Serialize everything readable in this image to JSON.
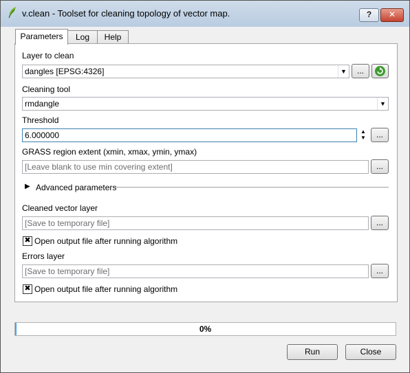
{
  "window": {
    "title": "v.clean - Toolset for cleaning topology of vector map.",
    "help_label": "?",
    "close_label": "✕"
  },
  "tabs": [
    {
      "label": "Parameters",
      "active": true
    },
    {
      "label": "Log",
      "active": false
    },
    {
      "label": "Help",
      "active": false
    }
  ],
  "params": {
    "layer_label": "Layer to clean",
    "layer_value": "dangles [EPSG:4326]",
    "cleaning_label": "Cleaning tool",
    "cleaning_value": "rmdangle",
    "threshold_label": "Threshold",
    "threshold_value": "6.000000",
    "region_label": "GRASS region extent (xmin, xmax, ymin, ymax)",
    "region_placeholder": "[Leave blank to use min covering extent]",
    "advanced_label": "Advanced parameters",
    "cleaned_label": "Cleaned vector layer",
    "cleaned_placeholder": "[Save to temporary file]",
    "cleaned_open_label": "Open output file after running algorithm",
    "cleaned_open_checked": true,
    "errors_label": "Errors layer",
    "errors_placeholder": "[Save to temporary file]",
    "errors_open_label": "Open output file after running algorithm",
    "errors_open_checked": true,
    "browse_label": "..."
  },
  "progress": {
    "value": 0,
    "text": "0%"
  },
  "buttons": {
    "run": "Run",
    "close": "Close"
  },
  "colors": {
    "progress": "#4aa3e8",
    "refresh_icon": "#3f9a2e"
  }
}
